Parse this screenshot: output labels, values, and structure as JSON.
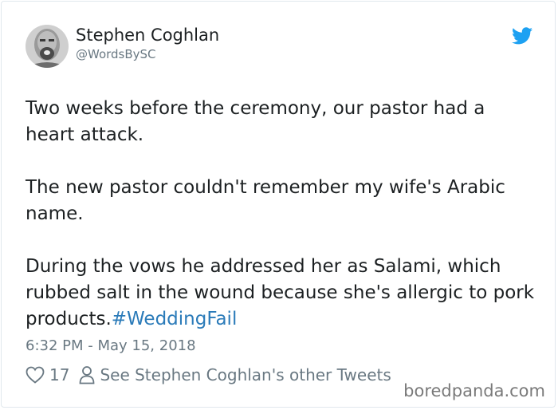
{
  "tweet": {
    "author_name": "Stephen Coghlan",
    "author_handle": "@WordsBySC",
    "text": "Two weeks before the ceremony, our pastor had a heart attack.\n\nThe new pastor couldn't remember my wife's Arabic name.\n\nDuring the vows he addressed her as Salami, which rubbed salt in the wound because she's allergic to pork products.",
    "hashtag": "#WeddingFail",
    "timestamp": "6:32 PM - May 15, 2018",
    "like_count": "17",
    "profile_link_label": "See Stephen Coghlan's other Tweets"
  },
  "icons": {
    "brand": "twitter-bird-icon",
    "like": "heart-icon",
    "profile": "person-icon"
  },
  "colors": {
    "brand": "#1da1f2",
    "link": "#2b7bb9",
    "muted": "#697882"
  },
  "watermark": "boredpanda.com"
}
